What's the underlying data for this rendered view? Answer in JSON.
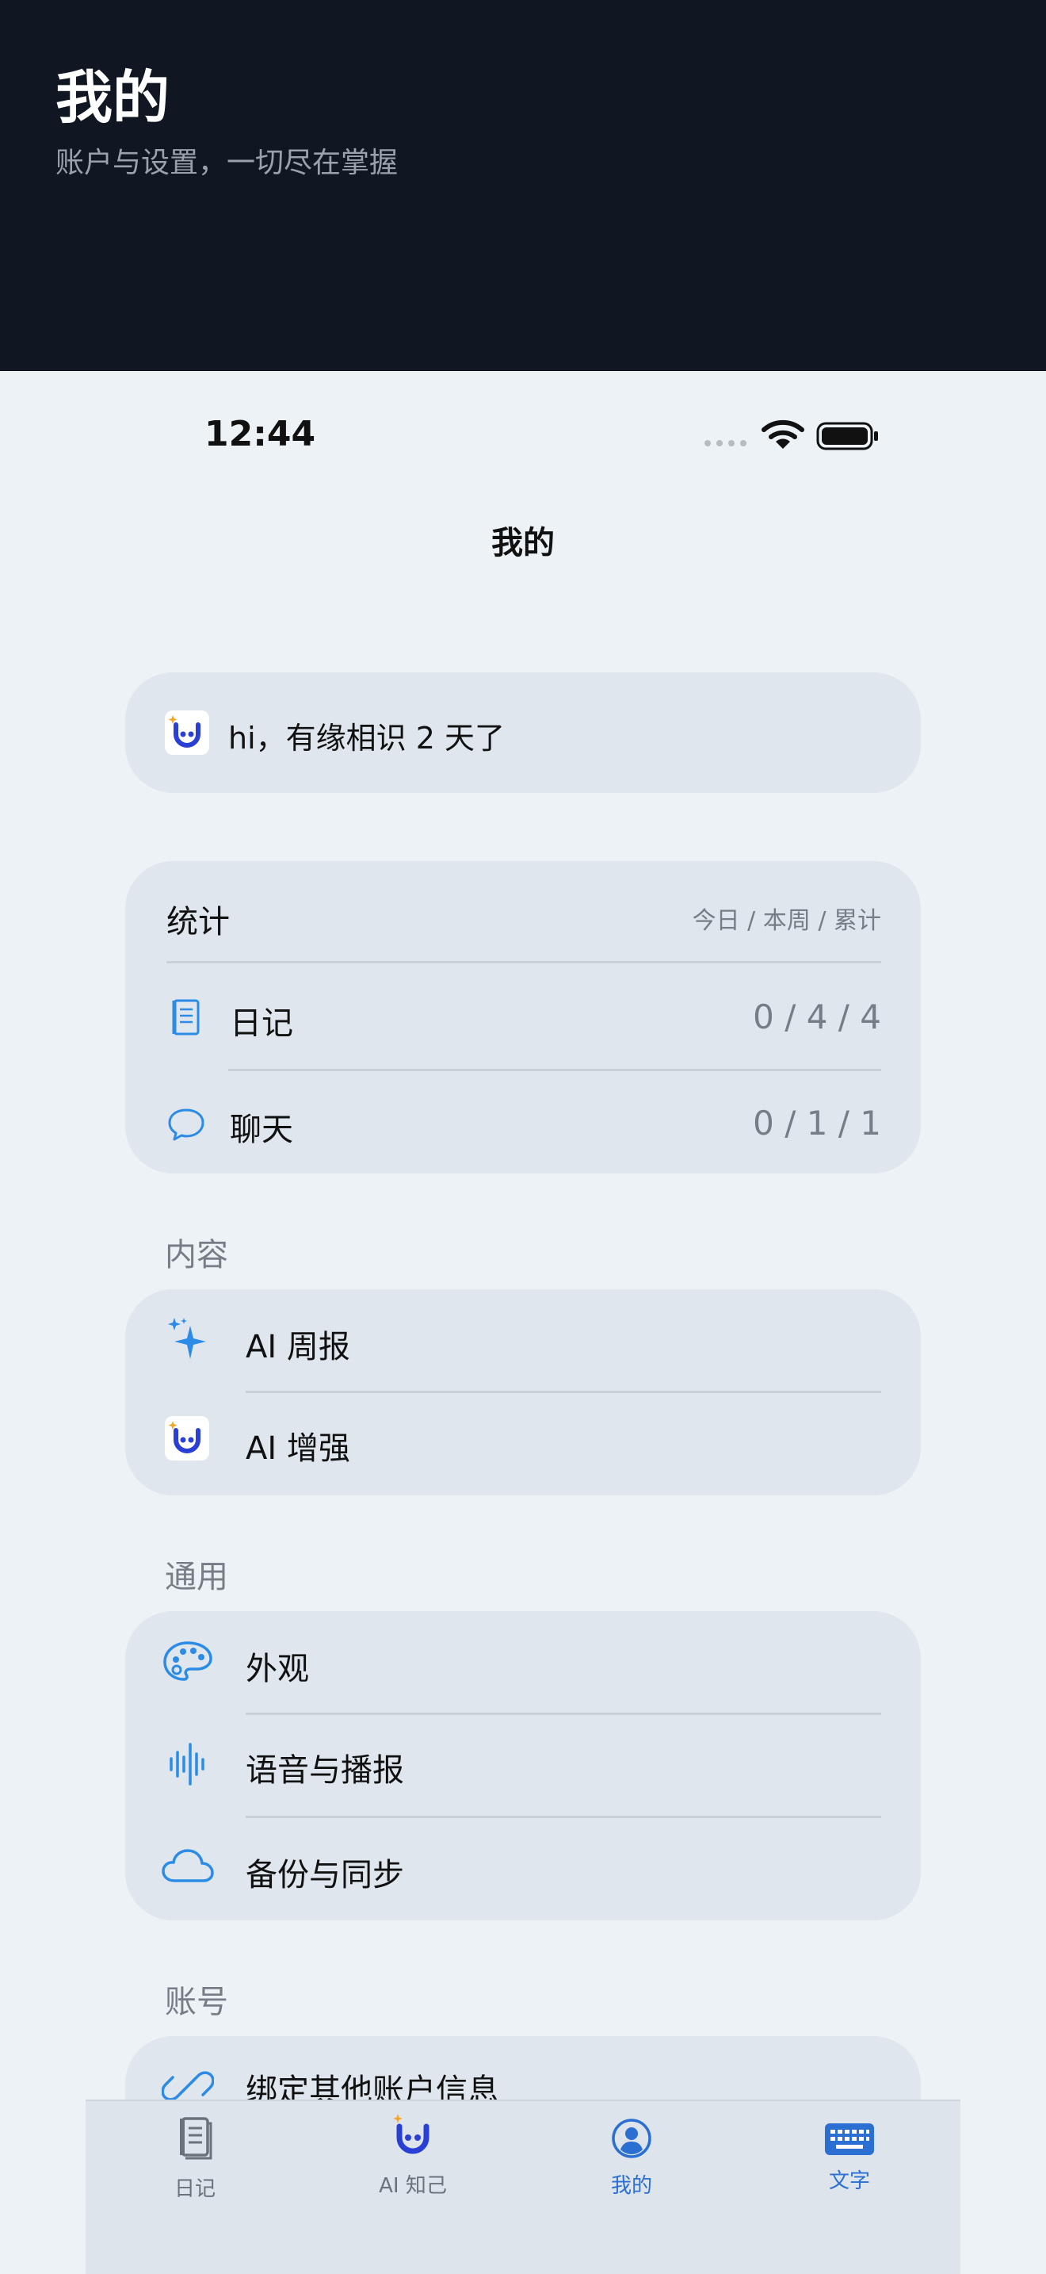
{
  "hero": {
    "title": "我的",
    "subtitle": "账户与设置，一切尽在掌握"
  },
  "status_bar": {
    "time": "12:44"
  },
  "nav": {
    "title": "我的"
  },
  "greeting": {
    "text": "hi，有缘相识 2 天了"
  },
  "stats": {
    "title": "统计",
    "period_labels": "今日 / 本周 / 累计",
    "rows": [
      {
        "label": "日记",
        "value": "0 / 4 / 4",
        "icon": "notebook-icon"
      },
      {
        "label": "聊天",
        "value": "0 / 1 / 1",
        "icon": "chat-bubble-icon"
      }
    ]
  },
  "sections": {
    "content": {
      "title": "内容",
      "items": [
        {
          "label": "AI 周报",
          "icon": "sparkle-icon"
        },
        {
          "label": "AI 增强",
          "icon": "smiley-logo-icon"
        }
      ]
    },
    "general": {
      "title": "通用",
      "items": [
        {
          "label": "外观",
          "icon": "palette-icon"
        },
        {
          "label": "语音与播报",
          "icon": "waveform-icon"
        },
        {
          "label": "备份与同步",
          "icon": "cloud-icon"
        }
      ]
    },
    "account": {
      "title": "账号",
      "items": [
        {
          "label": "绑定其他账户信息",
          "icon": "link-icon"
        }
      ]
    }
  },
  "tabbar": {
    "tabs": [
      {
        "label": "日记",
        "icon": "notebook-icon",
        "active": false
      },
      {
        "label": "AI 知己",
        "icon": "smiley-logo-icon",
        "active": false
      },
      {
        "label": "我的",
        "icon": "person-circle-icon",
        "active": true
      },
      {
        "label": "文字",
        "icon": "keyboard-icon",
        "active": false
      }
    ]
  },
  "colors": {
    "accent": "#2a6fd1",
    "icon_blue": "#2b8be6",
    "logo_blue": "#2a3fd4",
    "hero_bg": "#111722",
    "card_bg": "#dfe6ed",
    "page_bg": "#edf2f6",
    "muted": "#777d86"
  }
}
